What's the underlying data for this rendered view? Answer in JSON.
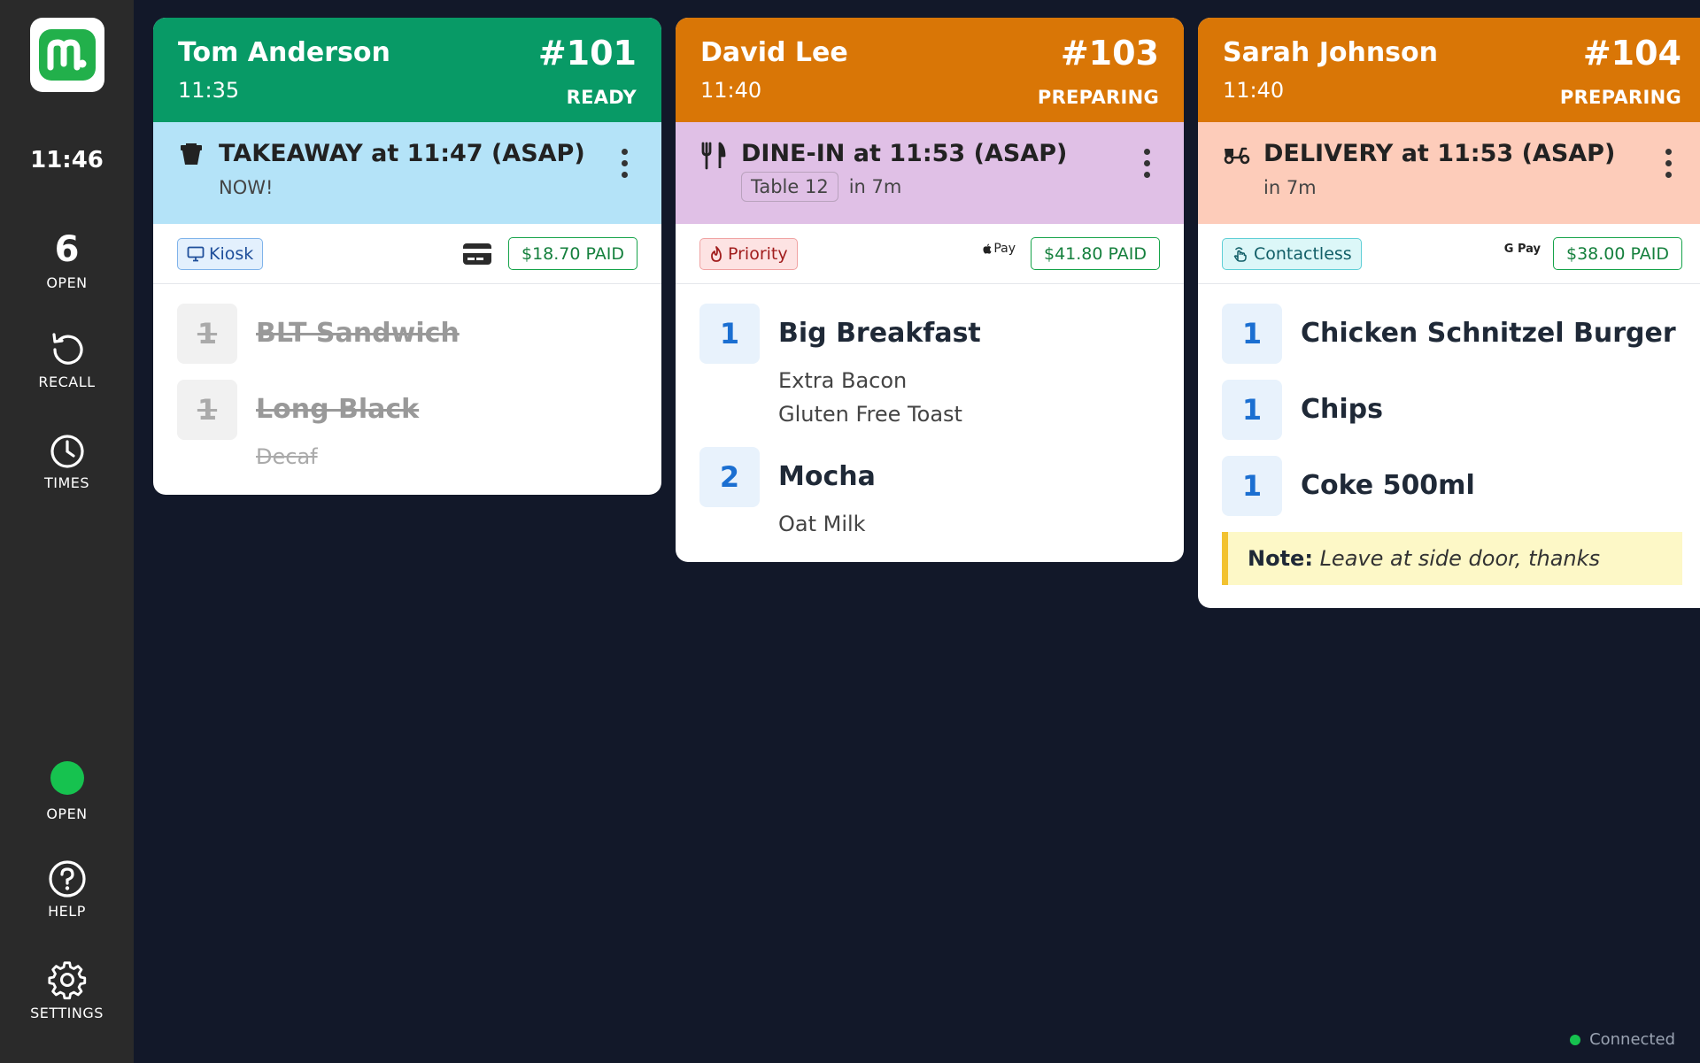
{
  "sidebar": {
    "clock": "11:46",
    "open_count": "6",
    "open_label": "OPEN",
    "recall_label": "RECALL",
    "times_label": "TIMES",
    "status_label": "OPEN",
    "help_label": "HELP",
    "settings_label": "SETTINGS"
  },
  "colors": {
    "ready": "#089a66",
    "preparing": "#d97606",
    "takeaway": "#b4e3f8",
    "dinein": "#e0c0e6",
    "delivery": "#fdccba"
  },
  "orders": [
    {
      "customer": "Tom Anderson",
      "time": "11:35",
      "number": "#101",
      "status": "READY",
      "service": "TAKEAWAY at 11:47 (ASAP)",
      "service_sub": "NOW!",
      "source": "Kiosk",
      "payment_icon": "card-icon",
      "paid": "$18.70 PAID",
      "items": [
        {
          "qty": "1",
          "name": "BLT Sandwich",
          "mods": []
        },
        {
          "qty": "1",
          "name": "Long Black",
          "mods": [
            "Decaf"
          ]
        }
      ]
    },
    {
      "customer": "David Lee",
      "time": "11:40",
      "number": "#103",
      "status": "PREPARING",
      "service": "DINE-IN at 11:53 (ASAP)",
      "table": "Table 12",
      "service_sub": "in 7m",
      "source": "Priority",
      "payment_label": "Pay",
      "paid": "$41.80 PAID",
      "items": [
        {
          "qty": "1",
          "name": "Big Breakfast",
          "mods": [
            "Extra Bacon",
            "Gluten Free Toast"
          ]
        },
        {
          "qty": "2",
          "name": "Mocha",
          "mods": [
            "Oat Milk"
          ]
        }
      ]
    },
    {
      "customer": "Sarah Johnson",
      "time": "11:40",
      "number": "#104",
      "status": "PREPARING",
      "service": "DELIVERY at 11:53 (ASAP)",
      "service_sub": "in 7m",
      "source": "Contactless",
      "payment_label": "G Pay",
      "paid": "$38.00 PAID",
      "items": [
        {
          "qty": "1",
          "name": "Chicken Schnitzel Burger",
          "mods": []
        },
        {
          "qty": "1",
          "name": "Chips",
          "mods": []
        },
        {
          "qty": "1",
          "name": "Coke 500ml",
          "mods": []
        }
      ],
      "note_label": "Note:",
      "note_text": "Leave at side door, thanks"
    }
  ],
  "connection": "Connected"
}
